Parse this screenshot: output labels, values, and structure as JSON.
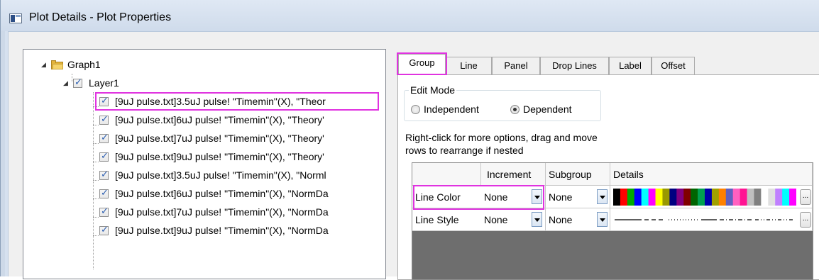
{
  "window": {
    "title": "Plot Details - Plot Properties"
  },
  "tree": {
    "root": "Graph1",
    "layer": "Layer1",
    "plots": [
      "[9uJ pulse.txt]3.5uJ pulse! \"Timemin\"(X), \"Theor",
      "[9uJ pulse.txt]6uJ pulse! \"Timemin\"(X), \"Theory'",
      "[9uJ pulse.txt]7uJ pulse! \"Timemin\"(X), \"Theory'",
      "[9uJ pulse.txt]9uJ pulse! \"Timemin\"(X), \"Theory'",
      "[9uJ pulse.txt]3.5uJ pulse! \"Timemin\"(X), \"Norml",
      "[9uJ pulse.txt]6uJ pulse! \"Timemin\"(X), \"NormDa",
      "[9uJ pulse.txt]7uJ pulse! \"Timemin\"(X), \"NormDa",
      "[9uJ pulse.txt]9uJ pulse! \"Timemin\"(X), \"NormDa"
    ]
  },
  "tabs": [
    "Group",
    "Line",
    "Panel",
    "Drop Lines",
    "Label",
    "Offset"
  ],
  "active_tab": "Group",
  "edit_mode": {
    "label": "Edit Mode",
    "options": [
      "Independent",
      "Dependent"
    ],
    "selected": "Dependent"
  },
  "help_text_line1": "Right-click for more options, drag and move",
  "help_text_line2": "rows to  rearrange if nested",
  "grid": {
    "headers": [
      "Increment",
      "Subgroup",
      "Details"
    ],
    "rows": [
      {
        "label": "Line Color",
        "increment": "None",
        "subgroup": "None"
      },
      {
        "label": "Line Style",
        "increment": "None",
        "subgroup": "None"
      }
    ],
    "ellipsis": "..."
  },
  "colors": {
    "highlight": "#e033e0",
    "palette": [
      "#000000",
      "#ff0000",
      "#00aa00",
      "#0000ff",
      "#00ffff",
      "#ff00ff",
      "#ffff00",
      "#999900",
      "#000080",
      "#800080",
      "#800000",
      "#006400",
      "#00a050",
      "#0000aa",
      "#a0a000",
      "#ff8000",
      "#6060c0",
      "#ff60c0",
      "#ff1493",
      "#c0c0c0",
      "#808080",
      "#ffffff",
      "#e0e0e0",
      "#c080ff",
      "#00ffff",
      "#ff00ff"
    ]
  }
}
